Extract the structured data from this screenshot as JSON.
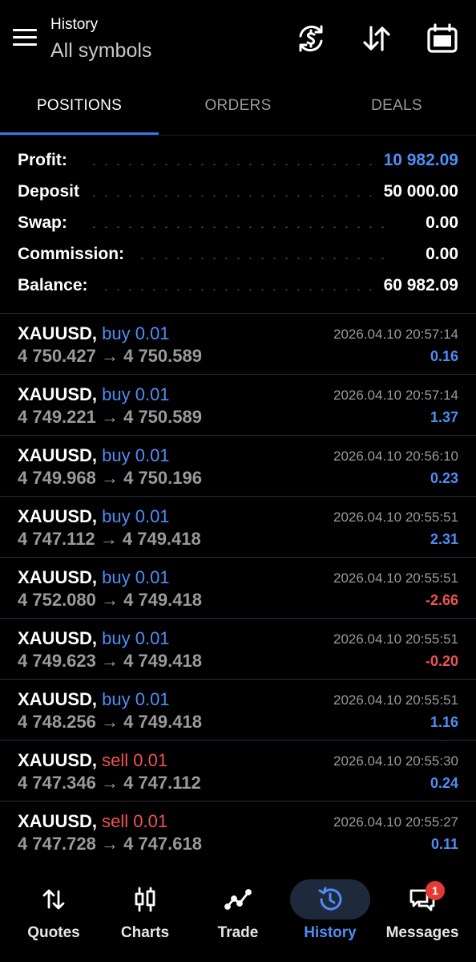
{
  "header": {
    "title": "History",
    "subtitle": "All symbols",
    "icons": [
      "currency-exchange-icon",
      "sort-icon",
      "calendar-icon"
    ]
  },
  "tabs": [
    {
      "label": "POSITIONS",
      "active": true
    },
    {
      "label": "ORDERS",
      "active": false
    },
    {
      "label": "DEALS",
      "active": false
    }
  ],
  "summary": {
    "profit_label": "Profit:",
    "profit_value": "10 982.09",
    "deposit_label": "Deposit",
    "deposit_value": "50 000.00",
    "swap_label": "Swap:",
    "swap_value": "0.00",
    "commission_label": "Commission:",
    "commission_value": "0.00",
    "balance_label": "Balance:",
    "balance_value": "60 982.09"
  },
  "deals": [
    {
      "symbol": "XAUUSD,",
      "side": "buy 0.01",
      "side_type": "buy",
      "prices": "4 750.427 → 4 750.589",
      "time": "2026.04.10 20:57:14",
      "profit": "0.16",
      "profit_sign": "pos"
    },
    {
      "symbol": "XAUUSD,",
      "side": "buy 0.01",
      "side_type": "buy",
      "prices": "4 749.221 → 4 750.589",
      "time": "2026.04.10 20:57:14",
      "profit": "1.37",
      "profit_sign": "pos"
    },
    {
      "symbol": "XAUUSD,",
      "side": "buy 0.01",
      "side_type": "buy",
      "prices": "4 749.968 → 4 750.196",
      "time": "2026.04.10 20:56:10",
      "profit": "0.23",
      "profit_sign": "pos"
    },
    {
      "symbol": "XAUUSD,",
      "side": "buy 0.01",
      "side_type": "buy",
      "prices": "4 747.112 → 4 749.418",
      "time": "2026.04.10 20:55:51",
      "profit": "2.31",
      "profit_sign": "pos"
    },
    {
      "symbol": "XAUUSD,",
      "side": "buy 0.01",
      "side_type": "buy",
      "prices": "4 752.080 → 4 749.418",
      "time": "2026.04.10 20:55:51",
      "profit": "-2.66",
      "profit_sign": "neg"
    },
    {
      "symbol": "XAUUSD,",
      "side": "buy 0.01",
      "side_type": "buy",
      "prices": "4 749.623 → 4 749.418",
      "time": "2026.04.10 20:55:51",
      "profit": "-0.20",
      "profit_sign": "neg"
    },
    {
      "symbol": "XAUUSD,",
      "side": "buy 0.01",
      "side_type": "buy",
      "prices": "4 748.256 → 4 749.418",
      "time": "2026.04.10 20:55:51",
      "profit": "1.16",
      "profit_sign": "pos"
    },
    {
      "symbol": "XAUUSD,",
      "side": "sell 0.01",
      "side_type": "sell",
      "prices": "4 747.346 → 4 747.112",
      "time": "2026.04.10 20:55:30",
      "profit": "0.24",
      "profit_sign": "pos"
    },
    {
      "symbol": "XAUUSD,",
      "side": "sell 0.01",
      "side_type": "sell",
      "prices": "4 747.728 → 4 747.618",
      "time": "2026.04.10 20:55:27",
      "profit": "0.11",
      "profit_sign": "pos"
    }
  ],
  "bottom_nav": [
    {
      "label": "Quotes",
      "icon": "quotes-arrows-icon",
      "active": false
    },
    {
      "label": "Charts",
      "icon": "candlestick-chart-icon",
      "active": false
    },
    {
      "label": "Trade",
      "icon": "trade-line-icon",
      "active": false
    },
    {
      "label": "History",
      "icon": "history-clock-icon",
      "active": true
    },
    {
      "label": "Messages",
      "icon": "messages-icon",
      "active": false,
      "badge": "1"
    }
  ],
  "colors": {
    "accent": "#4f8df5",
    "negative": "#f05454",
    "background": "#000000",
    "muted": "#9a9a9a"
  }
}
